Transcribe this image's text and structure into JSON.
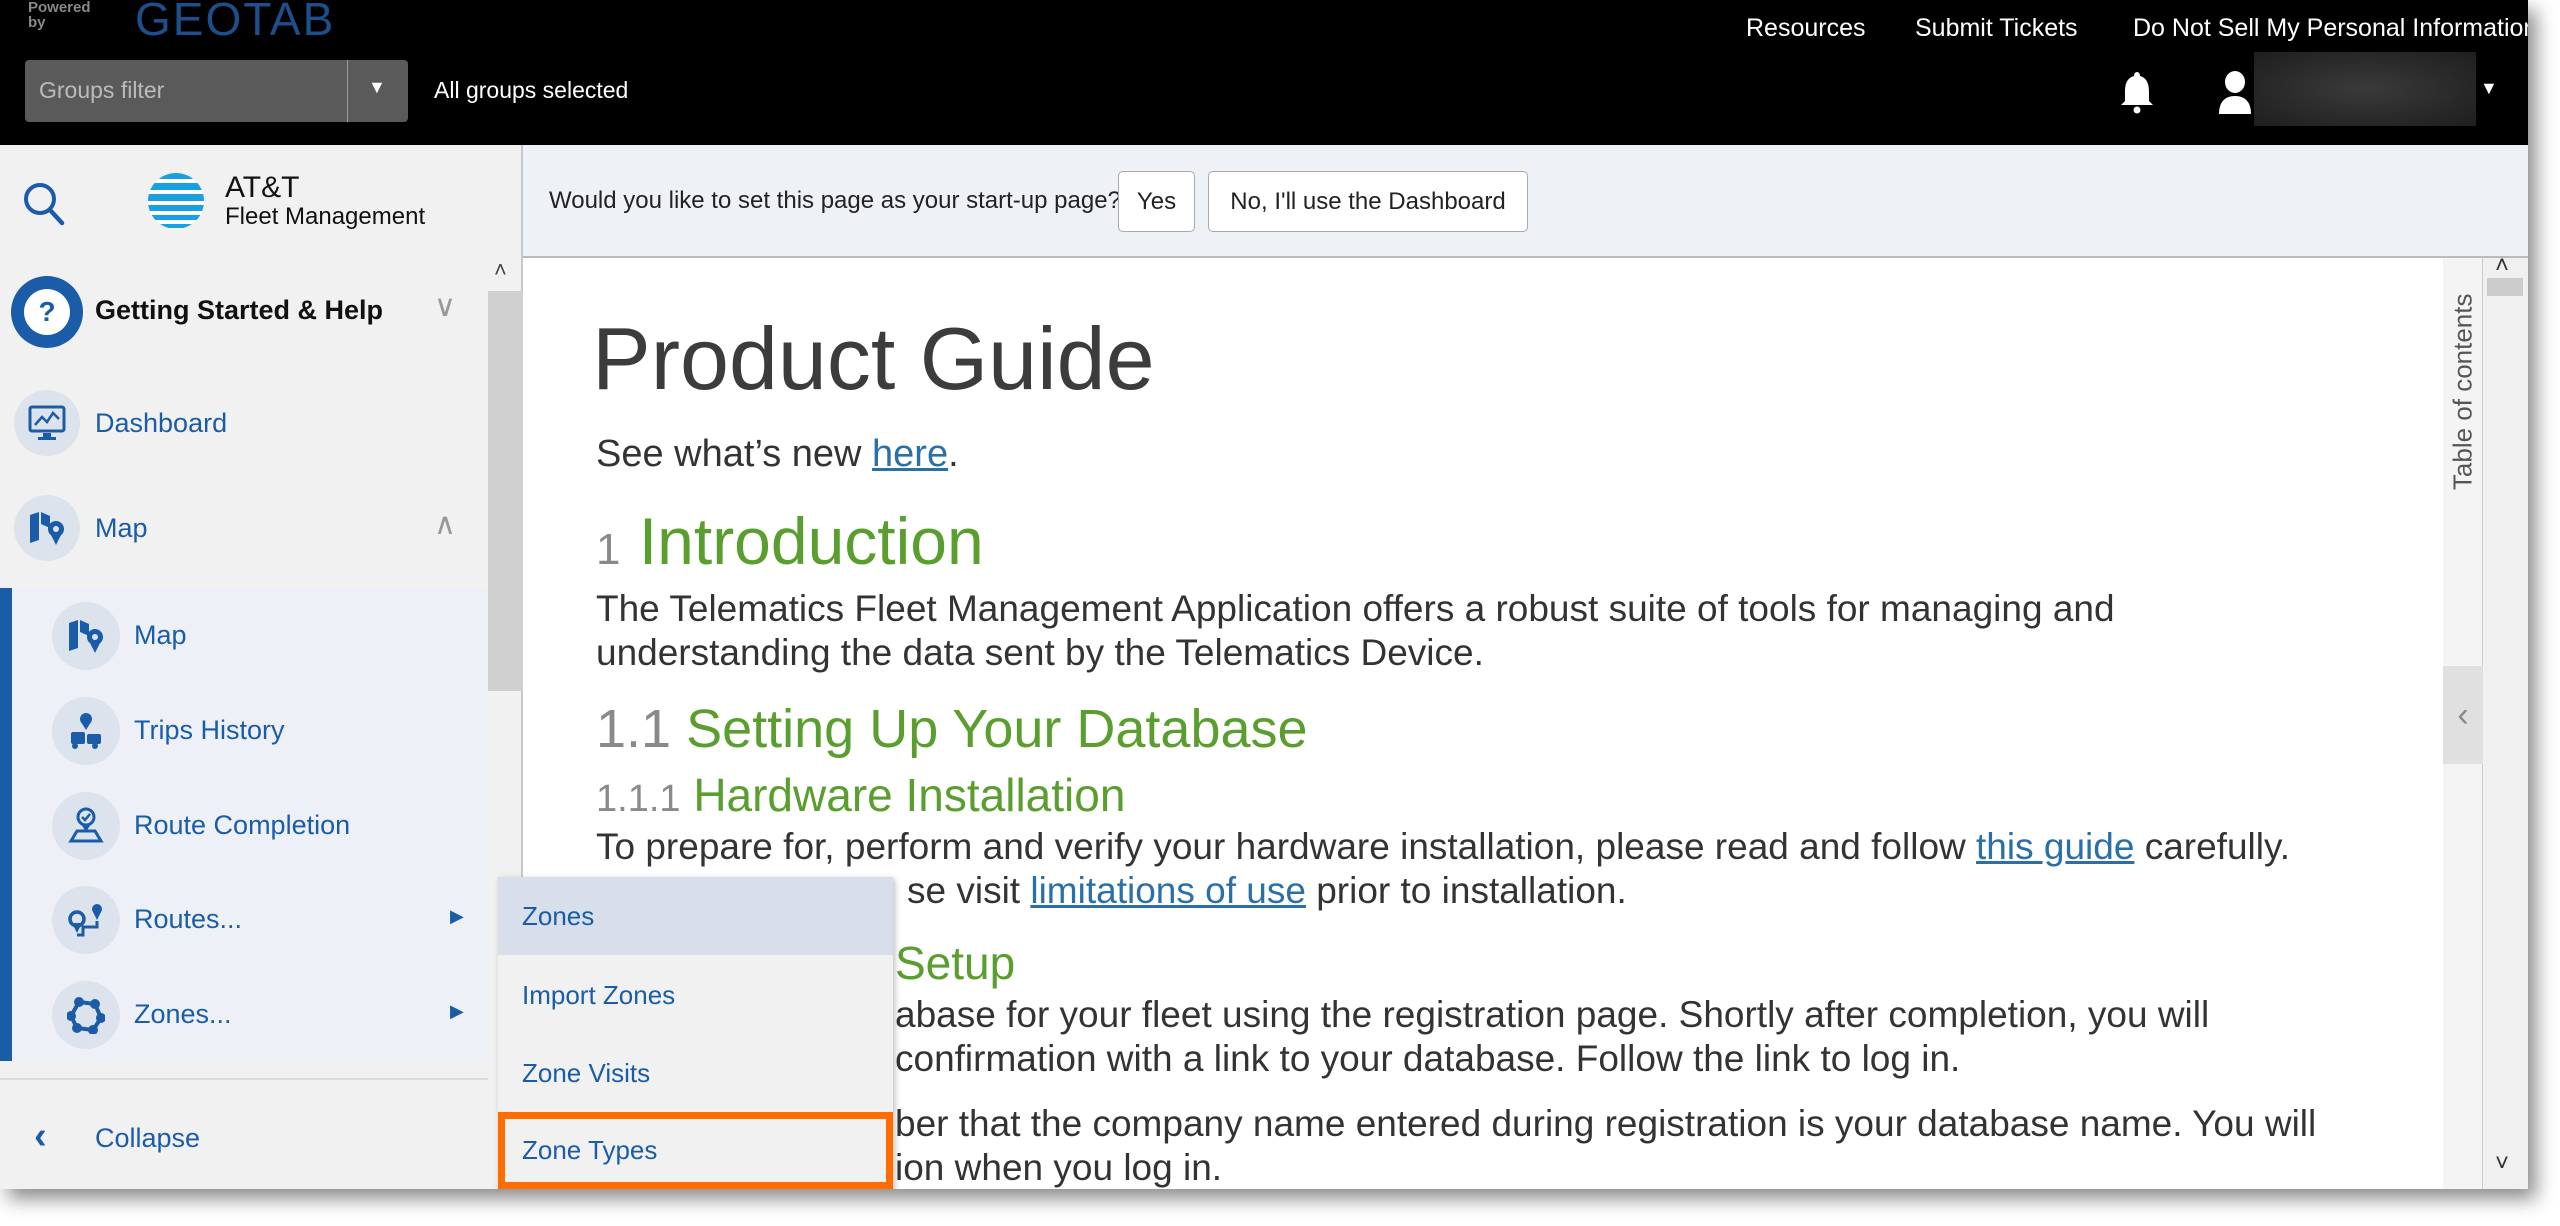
{
  "header": {
    "logo_powered": "Powered by",
    "logo_brand": "GEOTAB",
    "links": [
      "Resources",
      "Submit Tickets",
      "Do Not Sell My Personal Information"
    ],
    "groups_filter_placeholder": "Groups filter",
    "groups_status": "All groups selected"
  },
  "sidebar": {
    "brand_line1": "AT&T",
    "brand_line2": "Fleet Management",
    "items": [
      {
        "label": "Getting Started & Help",
        "icon": "help-icon"
      },
      {
        "label": "Dashboard",
        "icon": "dashboard-icon"
      },
      {
        "label": "Map",
        "icon": "map-icon"
      }
    ],
    "subitems": [
      {
        "label": "Map",
        "icon": "map-icon"
      },
      {
        "label": "Trips History",
        "icon": "trips-history-icon"
      },
      {
        "label": "Route Completion",
        "icon": "route-completion-icon"
      },
      {
        "label": "Routes...",
        "icon": "routes-icon"
      },
      {
        "label": "Zones...",
        "icon": "zones-icon"
      }
    ],
    "collapse_label": "Collapse"
  },
  "popup": {
    "items": [
      "Zones",
      "Import Zones",
      "Zone Visits",
      "Zone Types"
    ],
    "highlighted": "Zones",
    "outlined": "Zone Types"
  },
  "prompt": {
    "question": "Would you like to set this page as your start-up page?",
    "yes": "Yes",
    "no": "No, I'll use the Dashboard"
  },
  "doc": {
    "title": "Product Guide",
    "whatsnew_pre": "See what’s new ",
    "whatsnew_link": "here",
    "whatsnew_post": ".",
    "h1_num": "1",
    "h1": "Introduction",
    "intro_l1": "The Telematics Fleet Management Application offers a robust suite of tools for managing and",
    "intro_l2": "understanding the data sent by the Telematics Device.",
    "h2_num": "1.1",
    "h2": "Setting Up Your Database",
    "h3_num": "1.1.1",
    "h3": "Hardware Installation",
    "hw_l1_pre": "To prepare for, perform and verify your hardware installation, please read and follow ",
    "hw_l1_link": "this guide",
    "hw_l1_post": " carefully.",
    "hw_l2_pre": "se visit ",
    "hw_l2_link": "limitations of use",
    "hw_l2_post": " prior to installation.",
    "h4_frag": "Setup",
    "db_l1": "abase for your fleet using the registration page. Shortly after completion, you will",
    "db_l2": "confirmation with a link to your database. Follow the link to log in.",
    "db_l3": "ber that the company name entered during registration is your database name. You will",
    "db_l4": "ion when you log in."
  },
  "toc": {
    "label": "Table of contents"
  },
  "colors": {
    "accent_blue": "#1a5ca8",
    "heading_green": "#5a9e2f",
    "highlight_orange": "#ff6d00"
  }
}
